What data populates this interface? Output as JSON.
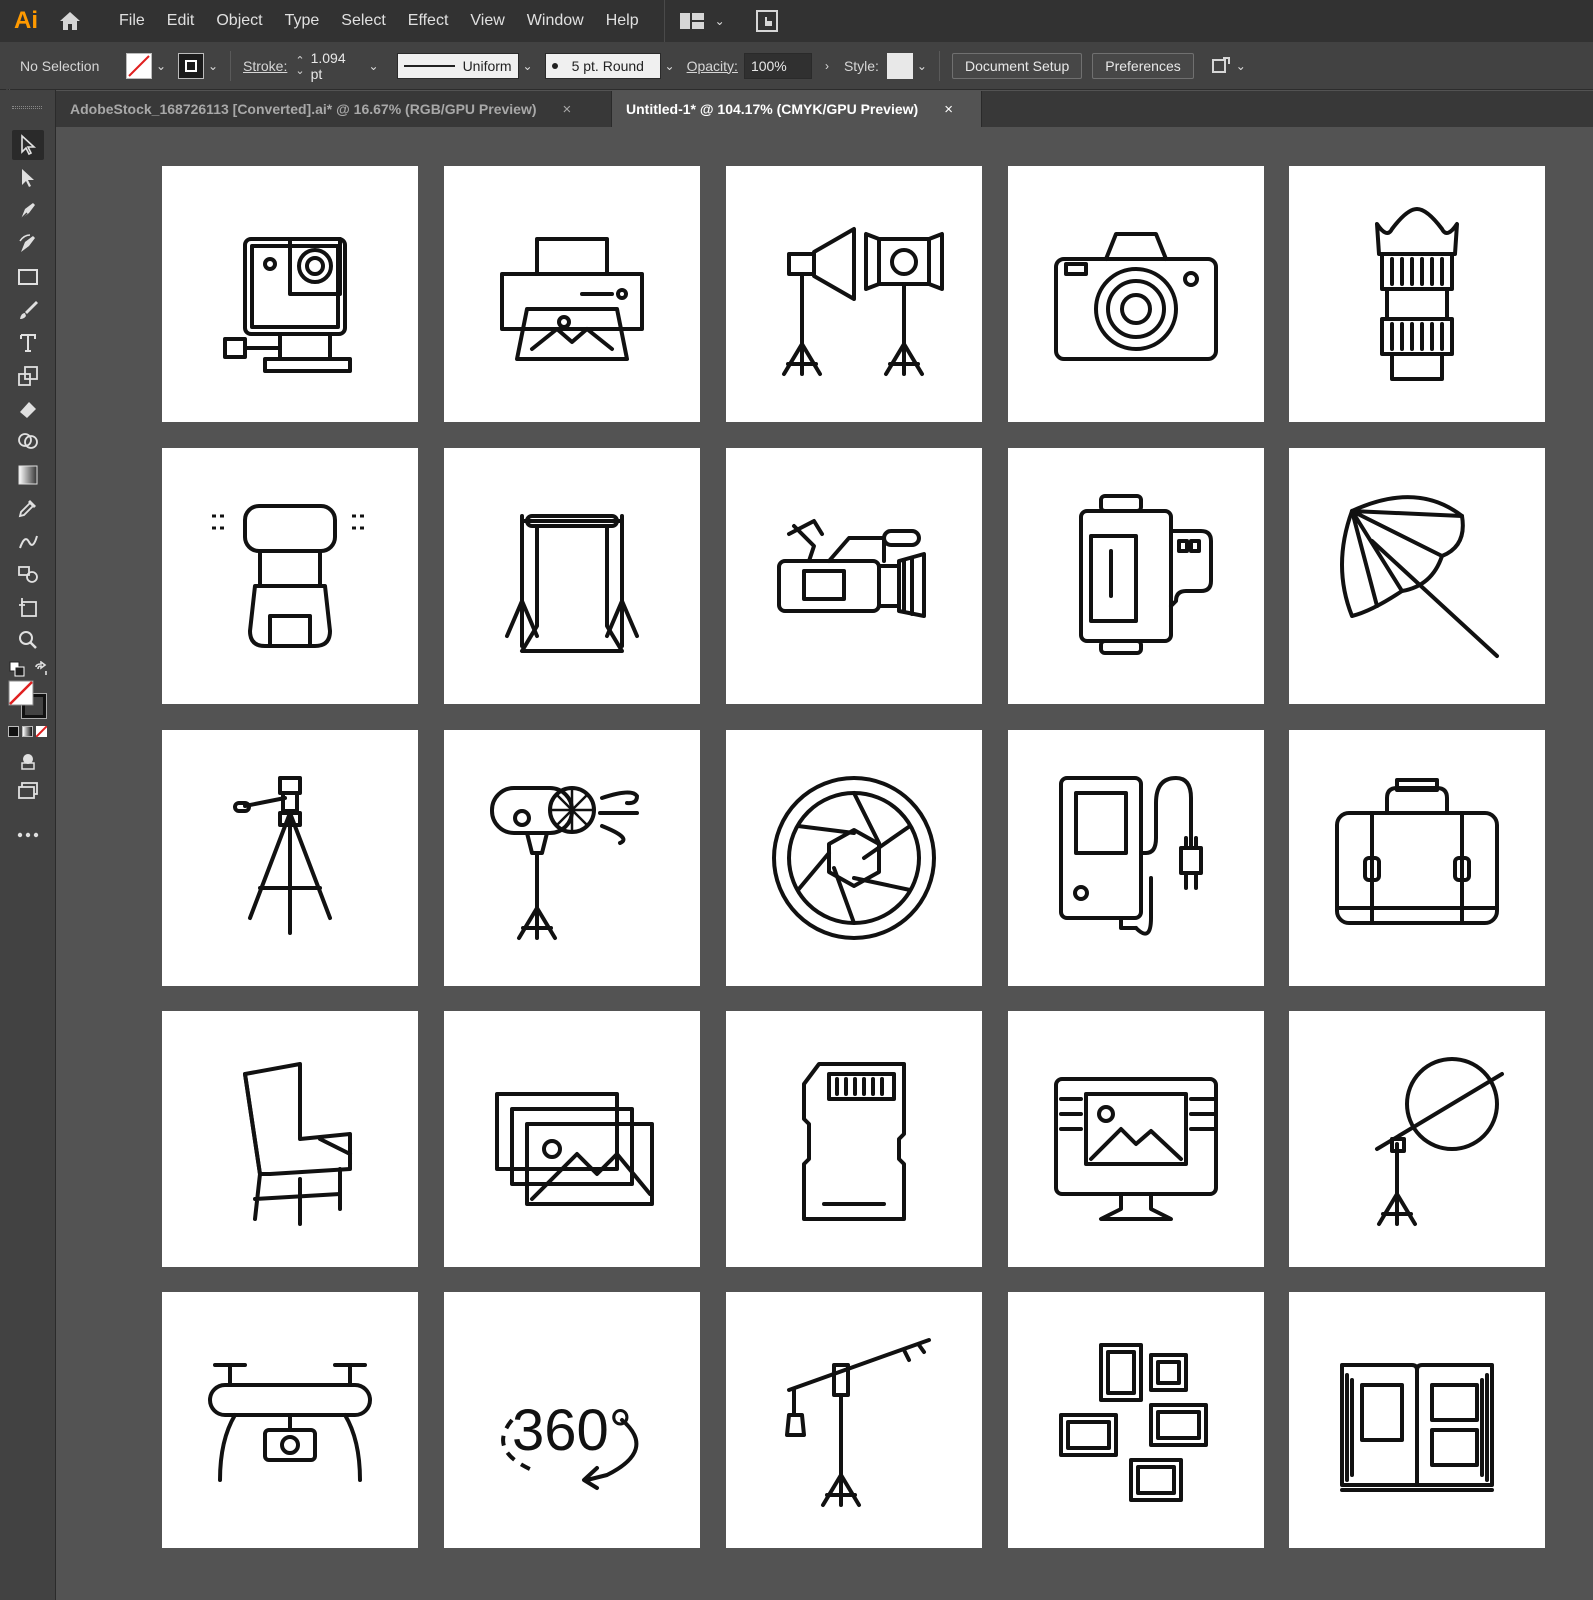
{
  "app": {
    "logo": "Ai"
  },
  "menu": [
    "File",
    "Edit",
    "Object",
    "Type",
    "Select",
    "Effect",
    "View",
    "Window",
    "Help"
  ],
  "control_bar": {
    "selection": "No Selection",
    "stroke_label": "Stroke:",
    "stroke_value": "1.094 pt",
    "profile": "Uniform",
    "brush": "5 pt. Round",
    "opacity_label": "Opacity:",
    "opacity_value": "100%",
    "style_label": "Style:",
    "document_setup": "Document Setup",
    "preferences": "Preferences"
  },
  "tabs": [
    {
      "label": "AdobeStock_168726113 [Converted].ai* @ 16.67% (RGB/GPU Preview)",
      "close": "×"
    },
    {
      "label": "Untitled-1* @ 104.17% (CMYK/GPU Preview)",
      "close": "×"
    }
  ],
  "icons_360_text": "360°",
  "artboards": [
    "action-camera-icon",
    "printer-icon",
    "studio-lights-icon",
    "dslr-camera-icon",
    "camera-lens-icon",
    "camera-flash-icon",
    "photo-backdrop-icon",
    "video-camcorder-icon",
    "film-roll-icon",
    "photo-umbrella-icon",
    "tripod-icon",
    "wind-machine-icon",
    "aperture-icon",
    "battery-charger-icon",
    "camera-bag-icon",
    "chair-icon",
    "photo-gallery-icon",
    "memory-card-icon",
    "photo-editor-monitor-icon",
    "reflector-stand-icon",
    "drone-icon",
    "360-view-icon",
    "boom-light-stand-icon",
    "photo-frames-wall-icon",
    "photo-album-icon"
  ],
  "colors": {
    "accent": "#ff9a00",
    "ui_dark": "#323232",
    "ui_panel": "#424242",
    "canvas": "#535353"
  }
}
